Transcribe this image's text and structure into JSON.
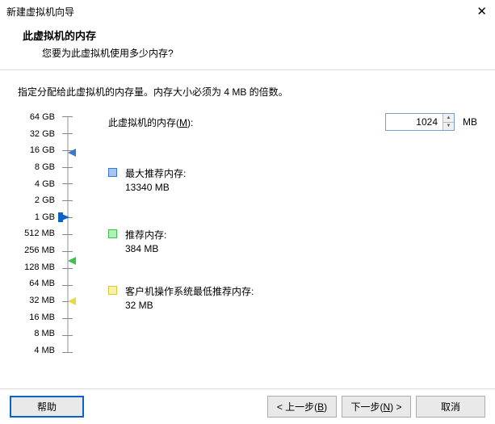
{
  "window": {
    "title": "新建虚拟机向导"
  },
  "header": {
    "title": "此虚拟机的内存",
    "subtitle": "您要为此虚拟机使用多少内存?"
  },
  "desc": "指定分配给此虚拟机的内存量。内存大小必须为 4 MB 的倍数。",
  "slider": {
    "labels": [
      "64 GB",
      "32 GB",
      "16 GB",
      "8 GB",
      "4 GB",
      "2 GB",
      "1 GB",
      "512 MB",
      "256 MB",
      "128 MB",
      "64 MB",
      "32 MB",
      "16 MB",
      "8 MB",
      "4 MB"
    ],
    "value_index": 6
  },
  "memory": {
    "label_prefix": "此虚拟机的内存(",
    "label_key": "M",
    "label_suffix": "):",
    "value": "1024",
    "unit": "MB"
  },
  "recs": {
    "max": {
      "title": "最大推荐内存:",
      "value": "13340 MB"
    },
    "rec": {
      "title": "推荐内存:",
      "value": "384 MB"
    },
    "min": {
      "title": "客户机操作系统最低推荐内存:",
      "value": "32 MB"
    }
  },
  "buttons": {
    "help": "帮助",
    "back_pre": "< 上一步(",
    "back_key": "B",
    "back_post": ")",
    "next_pre": "下一步(",
    "next_key": "N",
    "next_post": ") >",
    "cancel": "取消"
  }
}
